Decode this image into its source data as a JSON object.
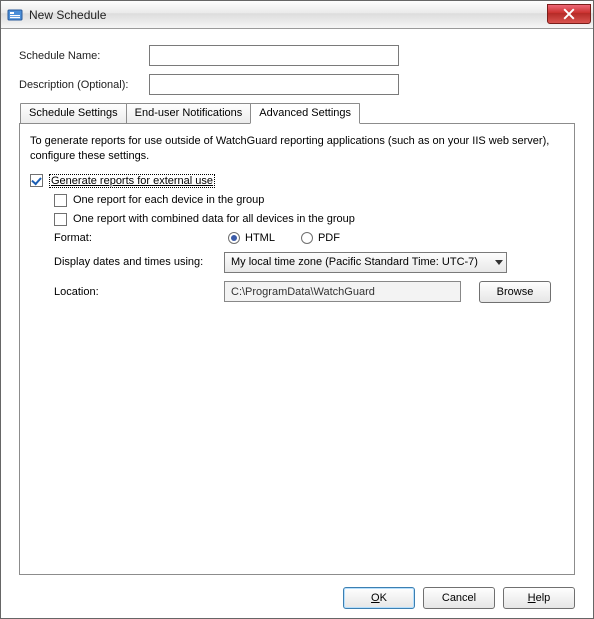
{
  "title": "New Schedule",
  "fields": {
    "schedule_name_label": "Schedule Name:",
    "schedule_name_value": "",
    "description_label": "Description (Optional):",
    "description_value": ""
  },
  "tabs": [
    {
      "label": "Schedule Settings"
    },
    {
      "label": "End-user Notifications"
    },
    {
      "label": "Advanced Settings"
    }
  ],
  "active_tab": 2,
  "panel": {
    "intro": "To generate reports for use outside of WatchGuard reporting applications (such as on your IIS web server), configure these settings.",
    "gen_checkbox_label": "Generate reports for external use",
    "gen_checked": true,
    "sub1_label": "One report for each device in the group",
    "sub1_checked": false,
    "sub2_label": "One report with combined data for all devices in the group",
    "sub2_checked": false,
    "format_label": "Format:",
    "format_options": {
      "html": "HTML",
      "pdf": "PDF"
    },
    "format_selected": "html",
    "tz_label": "Display dates and times using:",
    "tz_value": "My local time zone (Pacific Standard Time: UTC-7)",
    "location_label": "Location:",
    "location_value": "C:\\ProgramData\\WatchGuard",
    "browse_label": "Browse"
  },
  "buttons": {
    "ok": "OK",
    "cancel": "Cancel",
    "help": "Help"
  }
}
